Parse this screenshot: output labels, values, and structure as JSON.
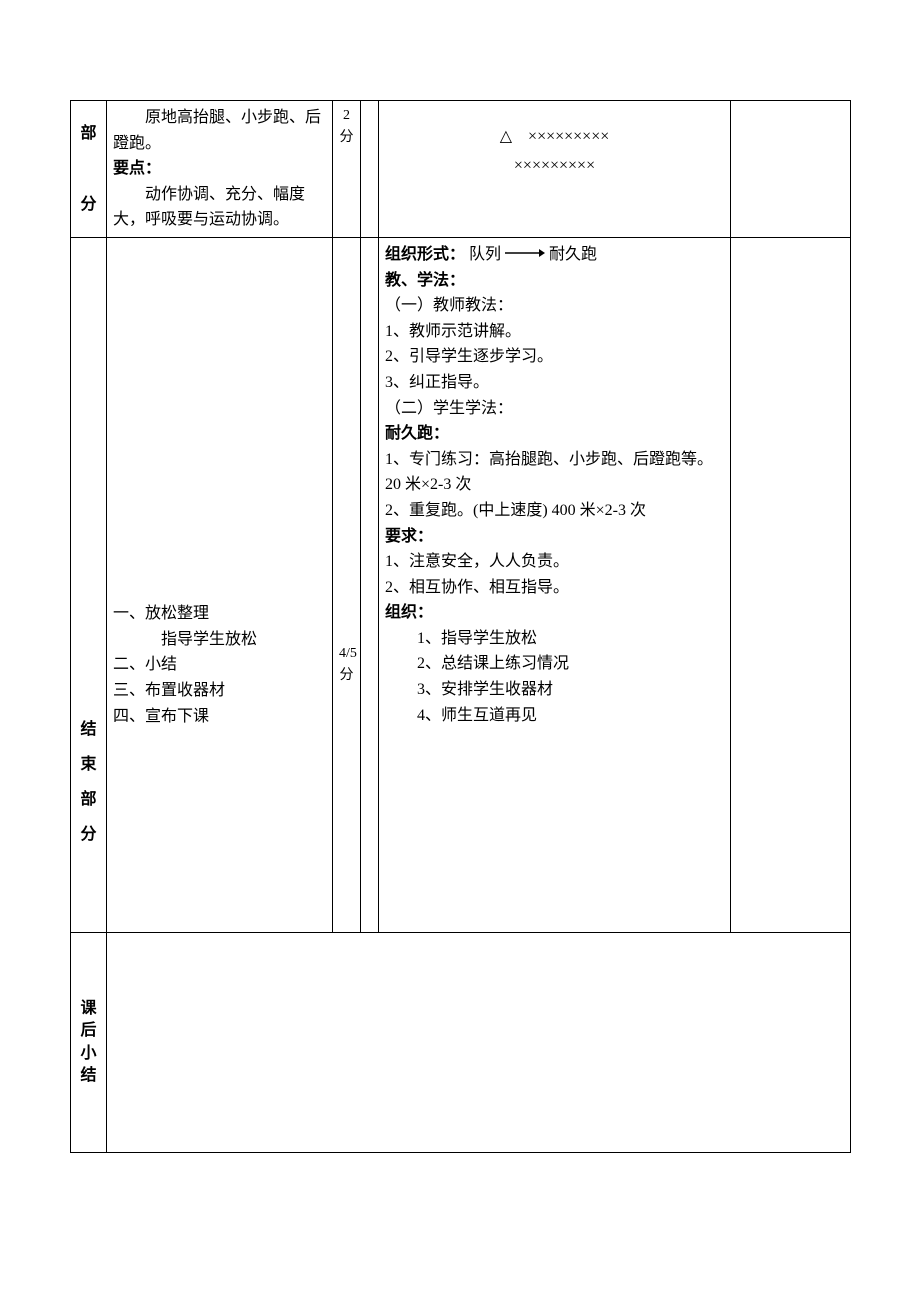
{
  "row1": {
    "sectionTop": "部",
    "sectionBottom": "分",
    "contentMain": "原地高抬腿、小步跑、后蹬跑。",
    "pointsLabel": "要点：",
    "pointsText": "动作协调、充分、幅度大，呼吸要与运动协调。",
    "time": "2分",
    "diagramLine1": "△　×××××××××",
    "diagramLine2": "×××××××××"
  },
  "row2": {
    "orgLabel": "组织形式：",
    "orgTextBefore": "队列",
    "orgTextAfter": "耐久跑",
    "methodLabel": "教、学法：",
    "teacherLabel": "（一）教师教法：",
    "t1": "1、教师示范讲解。",
    "t2": "2、引导学生逐步学习。",
    "t3": "3、纠正指导。",
    "studentLabel": "（二）学生学法：",
    "runLabel": "耐久跑：",
    "s1": "1、专门练习：高抬腿跑、小步跑、后蹬跑等。20 米×2-3 次",
    "s2": "2、重复跑。(中上速度) 400 米×2-3 次",
    "reqLabel": "要求：",
    "r1": "1、注意安全，人人负责。",
    "r2": "2、相互协作、相互指导。",
    "orgLabel2": "组织：",
    "o1": "1、指导学生放松",
    "o2": "2、总结课上练习情况",
    "o3": "3、安排学生收器材",
    "o4": "4、师生互道再见"
  },
  "row3": {
    "section": "结束部分",
    "c1a": "一、放松整理",
    "c1b": "指导学生放松",
    "c2": "二、小结",
    "c3": "三、布置收器材",
    "c4": "四、宣布下课",
    "time": "4/5分"
  },
  "row4": {
    "section": "课后小结"
  }
}
